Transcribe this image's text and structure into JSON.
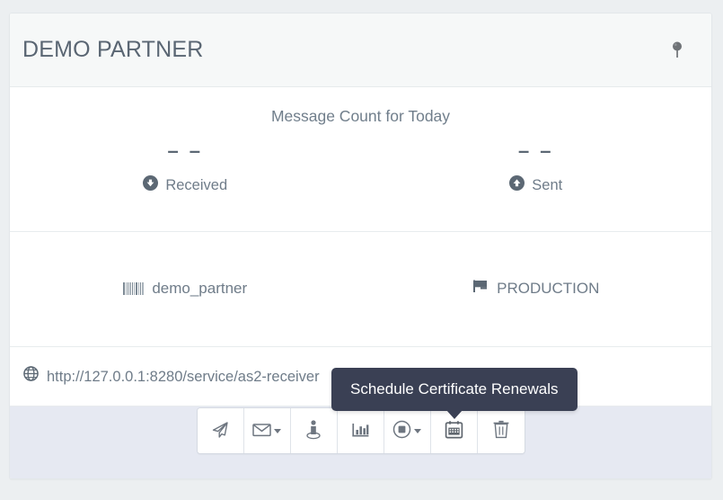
{
  "header": {
    "title": "DEMO PARTNER",
    "pin_icon": "pushpin-icon"
  },
  "counts": {
    "title": "Message Count for Today",
    "items": [
      {
        "value": "– –",
        "label": "Received",
        "icon": "arrow-circle-down-icon"
      },
      {
        "value": "– –",
        "label": "Sent",
        "icon": "arrow-circle-up-icon"
      }
    ]
  },
  "meta": {
    "items": [
      {
        "value": "demo_partner",
        "icon": "barcode-icon"
      },
      {
        "value": "PRODUCTION",
        "icon": "flag-icon"
      }
    ]
  },
  "endpoint": {
    "url": "http://127.0.0.1:8280/service/as2-receiver",
    "icon": "globe-icon"
  },
  "tooltip": {
    "text": "Schedule Certificate Renewals"
  },
  "toolbar": {
    "buttons": [
      {
        "name": "send-message-button",
        "icon": "paper-plane-icon",
        "caret": false
      },
      {
        "name": "message-menu-button",
        "icon": "envelope-icon",
        "caret": true
      },
      {
        "name": "certificates-button",
        "icon": "person-identity-icon",
        "caret": false
      },
      {
        "name": "statistics-button",
        "icon": "bar-chart-icon",
        "caret": false
      },
      {
        "name": "status-menu-button",
        "icon": "record-circle-icon",
        "caret": true
      },
      {
        "name": "schedule-certificate-renewals-button",
        "icon": "calendar-icon",
        "caret": false
      },
      {
        "name": "delete-partner-button",
        "icon": "trash-icon",
        "caret": false
      }
    ]
  },
  "colors": {
    "page_background": "#eceff1",
    "card_background": "#ffffff",
    "header_background": "#f6f8f8",
    "footer_background": "#e6e9f2",
    "tooltip_background": "#3a4054",
    "text": "#6f7c89",
    "title_text": "#5a6673"
  }
}
